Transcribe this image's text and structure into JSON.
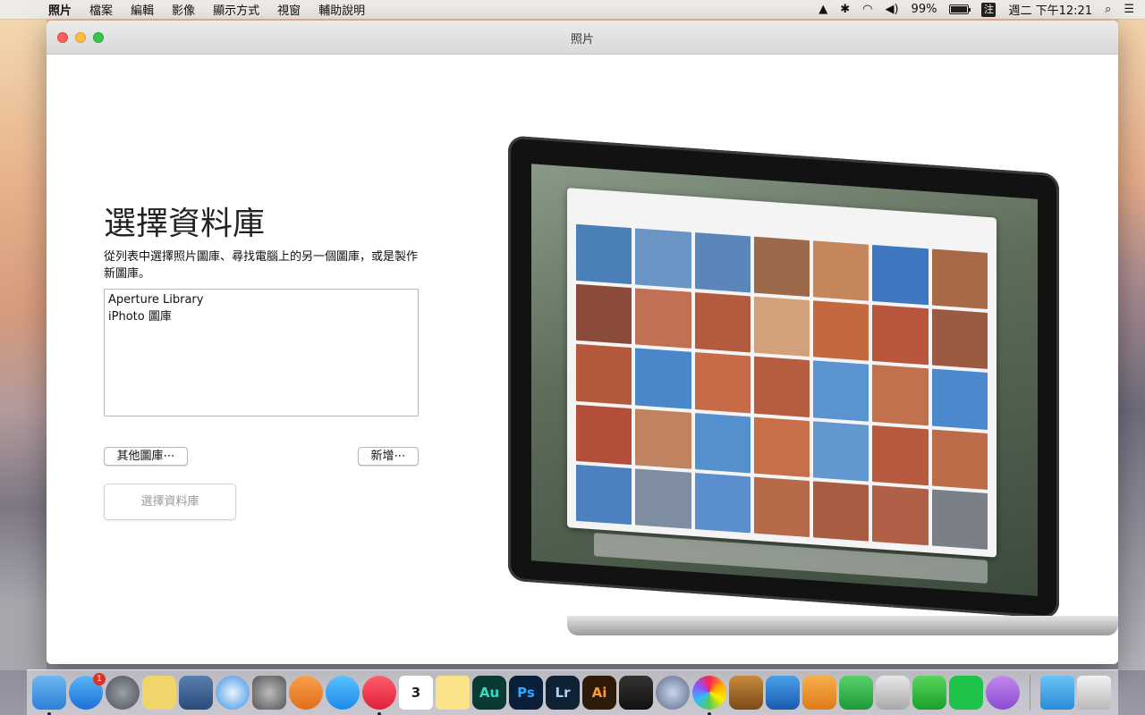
{
  "menubar": {
    "app_name": "照片",
    "items": [
      "檔案",
      "編輯",
      "影像",
      "顯示方式",
      "視窗",
      "輔助說明"
    ],
    "battery_percent": "99%",
    "ime": "注",
    "clock": "週二 下午12:21"
  },
  "window": {
    "title": "照片"
  },
  "main": {
    "heading": "選擇資料庫",
    "description": "從列表中選擇照片圖庫、尋找電腦上的另一個圖庫，或是製作新圖庫。",
    "libraries": [
      "Aperture Library",
      "iPhoto 圖庫"
    ],
    "other_library_button": "其他圖庫⋯",
    "new_button": "新增⋯",
    "choose_button": "選擇資料庫"
  },
  "dock": {
    "app_store_badge": "1",
    "calendar_day": "3",
    "labels": {
      "au": "Au",
      "ps": "Ps",
      "lr": "Lr",
      "ai": "Ai"
    }
  }
}
